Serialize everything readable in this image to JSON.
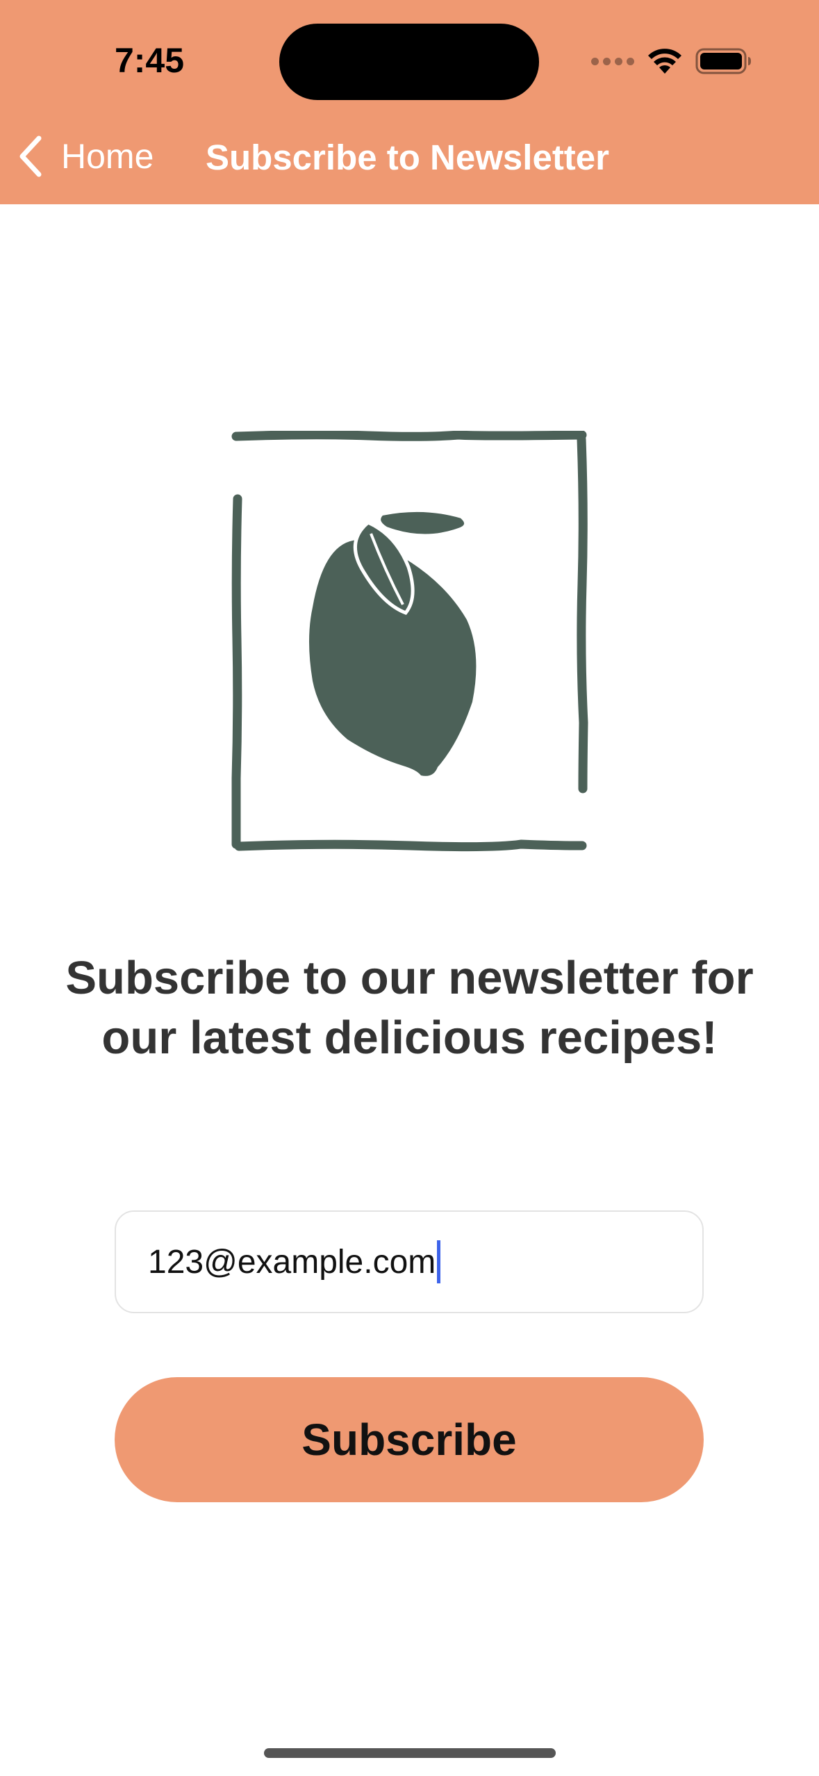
{
  "colors": {
    "accent": "#ef9972",
    "logo_green": "#4c6158",
    "headline_text": "#333333",
    "caret": "#3d63ea"
  },
  "status_bar": {
    "time": "7:45",
    "icons": [
      "cellular-signal-icon",
      "wifi-icon",
      "battery-icon"
    ]
  },
  "nav": {
    "back_label": "Home",
    "title": "Subscribe to Newsletter"
  },
  "main": {
    "logo_icon": "lemon-in-frame-logo",
    "headline": "Subscribe to our newsletter for our latest delicious recipes!",
    "email_input": {
      "value": "123@example.com"
    },
    "subscribe_label": "Subscribe"
  }
}
